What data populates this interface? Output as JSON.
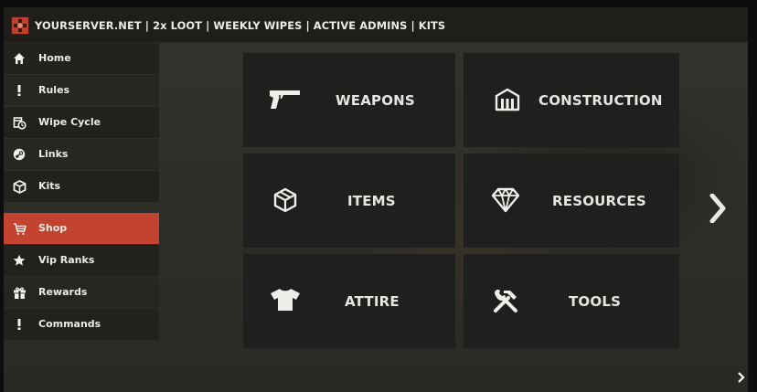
{
  "header": {
    "title": "YOURSERVER.NET | 2x LOOT | WEEKLY WIPES | ACTIVE ADMINS | KITS",
    "logo_icon": "rust-logo-icon",
    "logo_color": "#c1402b"
  },
  "sidebar": {
    "active_color": "#c2432f",
    "items": [
      {
        "label": "Home",
        "icon": "home-icon",
        "active": false
      },
      {
        "label": "Rules",
        "icon": "exclamation-icon",
        "active": false
      },
      {
        "label": "Wipe Cycle",
        "icon": "calendar-clock-icon",
        "active": false
      },
      {
        "label": "Links",
        "icon": "steam-icon",
        "active": false
      },
      {
        "label": "Kits",
        "icon": "cube-icon",
        "active": false
      },
      {
        "label": "Shop",
        "icon": "cart-icon",
        "active": true
      },
      {
        "label": "Vip Ranks",
        "icon": "star-icon",
        "active": false
      },
      {
        "label": "Rewards",
        "icon": "gift-icon",
        "active": false
      },
      {
        "label": "Commands",
        "icon": "exclamation-icon",
        "active": false
      }
    ]
  },
  "shop": {
    "categories": [
      {
        "label": "WEAPONS",
        "icon": "pistol-icon"
      },
      {
        "label": "CONSTRUCTION",
        "icon": "building-icon"
      },
      {
        "label": "ITEMS",
        "icon": "box-icon"
      },
      {
        "label": "RESOURCES",
        "icon": "diamond-icon"
      },
      {
        "label": "ATTIRE",
        "icon": "tshirt-icon"
      },
      {
        "label": "TOOLS",
        "icon": "tools-icon"
      }
    ],
    "next_page_icon": "chevron-right-icon",
    "corner_icon": "chevron-right-small-icon"
  }
}
